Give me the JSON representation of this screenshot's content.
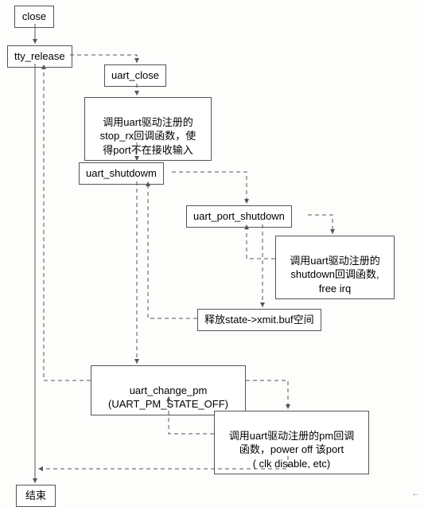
{
  "nodes": {
    "close": "close",
    "tty_release": "tty_release",
    "uart_close": "uart_close",
    "stop_rx": "调用uart驱动注册的\nstop_rx回调函数，使\n得port不在接收输入",
    "uart_shutdown": "uart_shutdowm",
    "uart_port_shutdown": "uart_port_shutdown",
    "shutdown_cb": "调用uart驱动注册的\nshutdown回调函数,\nfree irq",
    "free_xmit": "释放state->xmit.buf空间",
    "uart_change_pm": "uart_change_pm\n(UART_PM_STATE_OFF)",
    "pm_cb": "调用uart驱动注册的pm回调\n函数，power off 该port\n( clk disable, etc)",
    "end": "结束"
  },
  "footer_mark": "←"
}
